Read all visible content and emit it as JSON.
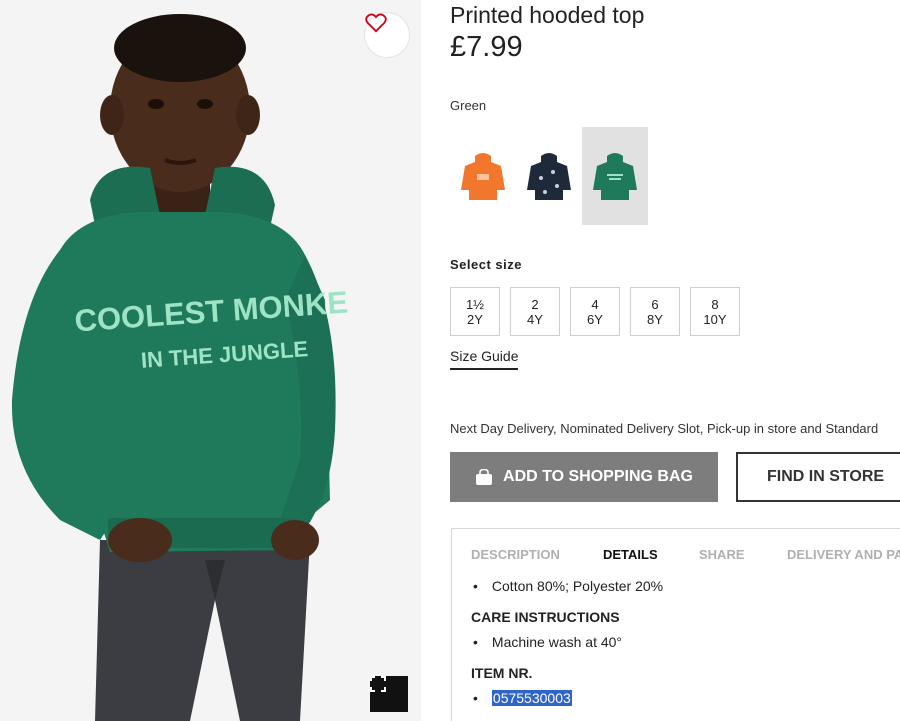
{
  "product": {
    "title": "Printed hooded top",
    "price": "£7.99",
    "color_name": "Green",
    "image_text_line1": "COOLEST MONKE",
    "image_text_line2": "IN THE JUNGLE"
  },
  "swatches": [
    {
      "name": "orange",
      "color": "#f0772b",
      "selected": false
    },
    {
      "name": "navy",
      "color": "#1e2a3a",
      "selected": false
    },
    {
      "name": "green",
      "color": "#1f7a5b",
      "selected": true
    }
  ],
  "sizes": {
    "label": "Select size",
    "options": [
      {
        "top": "1½",
        "bottom": "2Y"
      },
      {
        "top": "2",
        "bottom": "4Y"
      },
      {
        "top": "4",
        "bottom": "6Y"
      },
      {
        "top": "6",
        "bottom": "8Y"
      },
      {
        "top": "8",
        "bottom": "10Y"
      }
    ],
    "guide_label": "Size Guide"
  },
  "delivery_text": "Next Day Delivery, Nominated Delivery Slot, Pick-up in store and Standard",
  "buttons": {
    "add_to_bag": "ADD TO SHOPPING BAG",
    "find_in_store": "FIND IN STORE"
  },
  "tabs": [
    {
      "label": "DESCRIPTION",
      "active": false
    },
    {
      "label": "DETAILS",
      "active": true
    },
    {
      "label": "SHARE",
      "active": false
    },
    {
      "label": "DELIVERY AND PA",
      "active": false
    }
  ],
  "details": {
    "composition": "Cotton 80%; Polyester 20%",
    "care_heading": "CARE INSTRUCTIONS",
    "care_item": "Machine wash at 40°",
    "item_heading": "ITEM NR.",
    "item_number": "0575530003"
  },
  "icons": {
    "wishlist": "heart-icon",
    "zoom": "expand-icon",
    "bag": "shopping-bag-icon"
  },
  "colors": {
    "hoodie_green": "#1f7a5b",
    "heart_red": "#d0021b",
    "button_grey": "#7d7d7d",
    "selection_blue": "#2f64c9"
  }
}
